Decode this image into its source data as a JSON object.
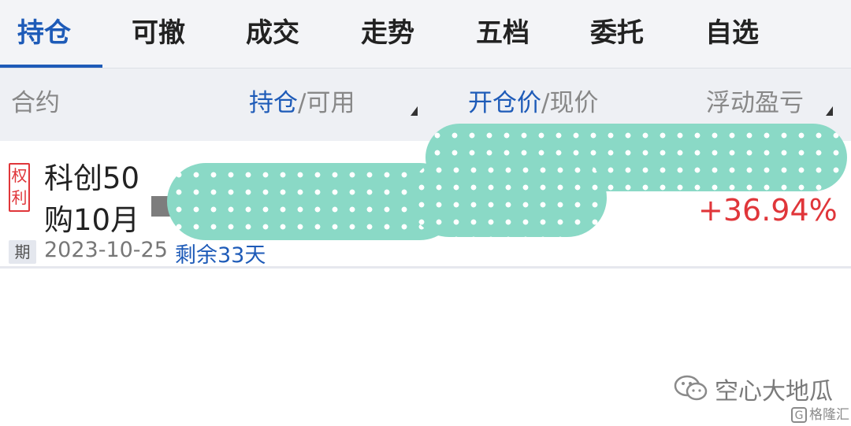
{
  "tabs": [
    {
      "label": "持仓",
      "active": true
    },
    {
      "label": "可撤",
      "active": false
    },
    {
      "label": "成交",
      "active": false
    },
    {
      "label": "走势",
      "active": false
    },
    {
      "label": "五档",
      "active": false
    },
    {
      "label": "委托",
      "active": false
    },
    {
      "label": "自选",
      "active": false
    }
  ],
  "columns": {
    "contract": "合约",
    "position_hl": "持仓",
    "position_rest": "/可用",
    "price_hl": "开仓价",
    "price_rest": "/现价",
    "pnl": "浮动盈亏"
  },
  "position": {
    "badge_line1": "权",
    "badge_line2": "利",
    "name_line1": "科创50",
    "name_line2": "购10月",
    "pnl_pct": "+36.94%",
    "expiry_tag": "期",
    "expiry_date": "2023-10-25",
    "days_left": "剩余33天"
  },
  "watermark": {
    "account_name": "空心大地瓜",
    "site_name": "格隆汇",
    "icon": "wechat-icon"
  },
  "colors": {
    "accent": "#1e5bb8",
    "gain": "#e0363a",
    "redaction": "#8ad9c6"
  }
}
